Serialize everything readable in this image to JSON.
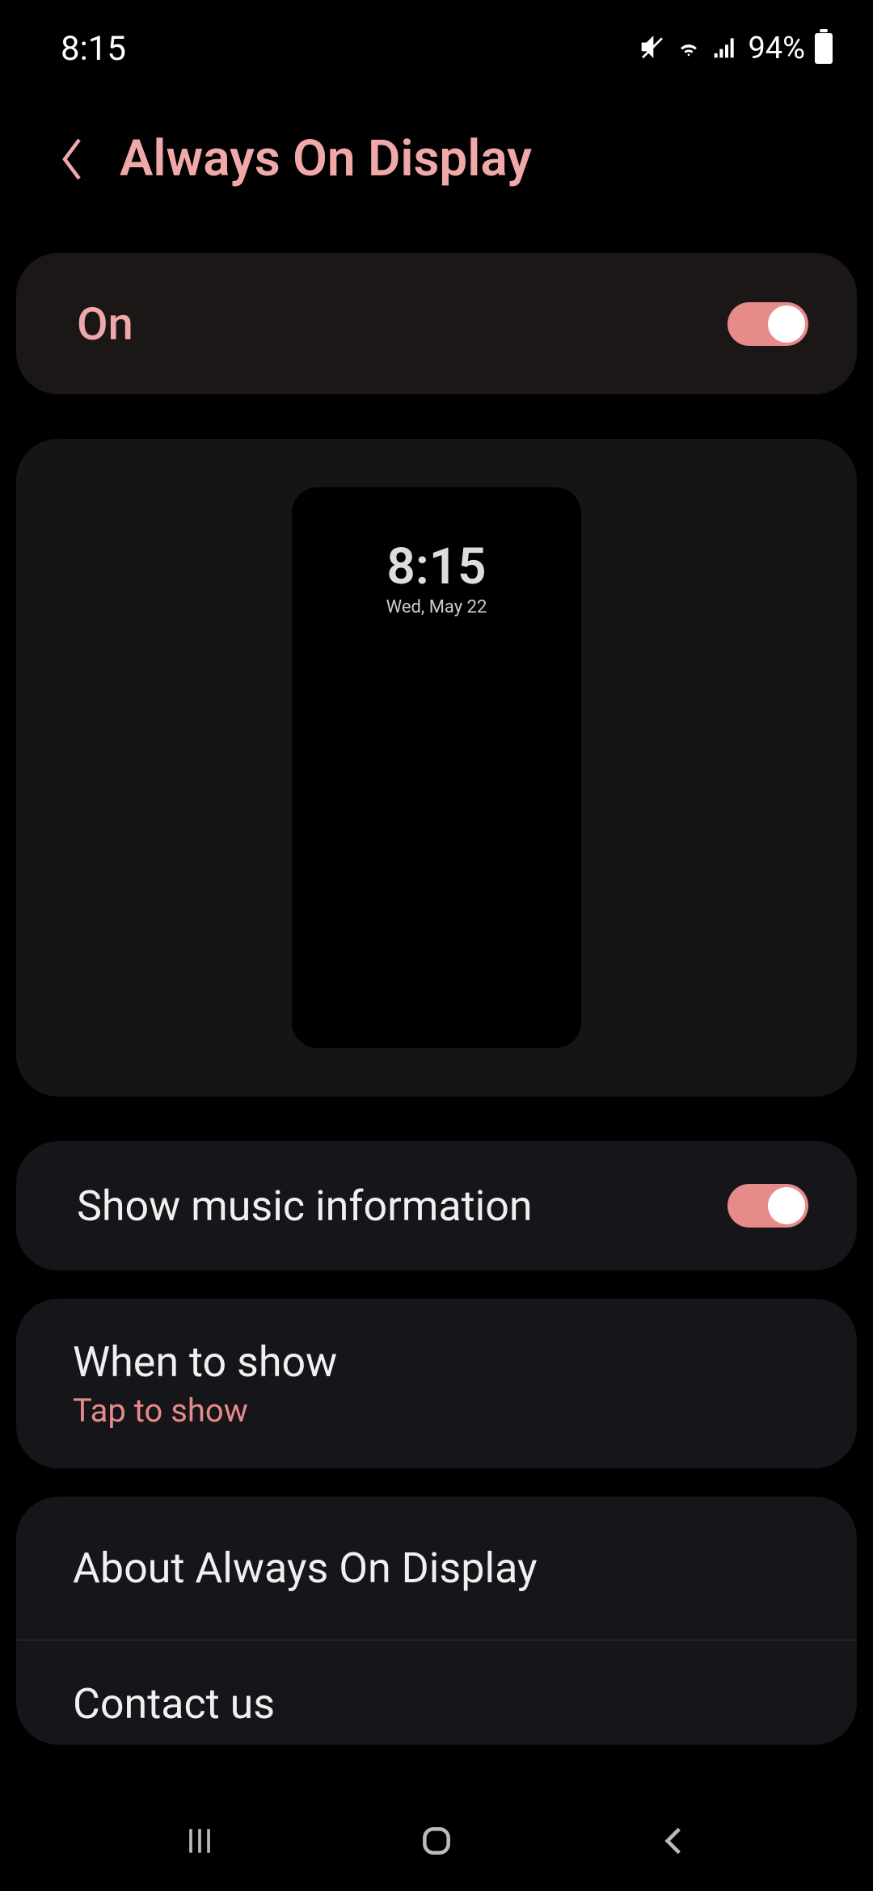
{
  "status": {
    "time": "8:15",
    "battery_pct": "94%"
  },
  "header": {
    "title": "Always On Display"
  },
  "main_toggle": {
    "label": "On",
    "enabled": true
  },
  "preview": {
    "time": "8:15",
    "date": "Wed, May 22"
  },
  "settings": {
    "music": {
      "label": "Show music information",
      "enabled": true
    },
    "when": {
      "label": "When to show",
      "value": "Tap to show"
    },
    "about": {
      "label": "About Always On Display"
    },
    "contact": {
      "label": "Contact us"
    }
  }
}
